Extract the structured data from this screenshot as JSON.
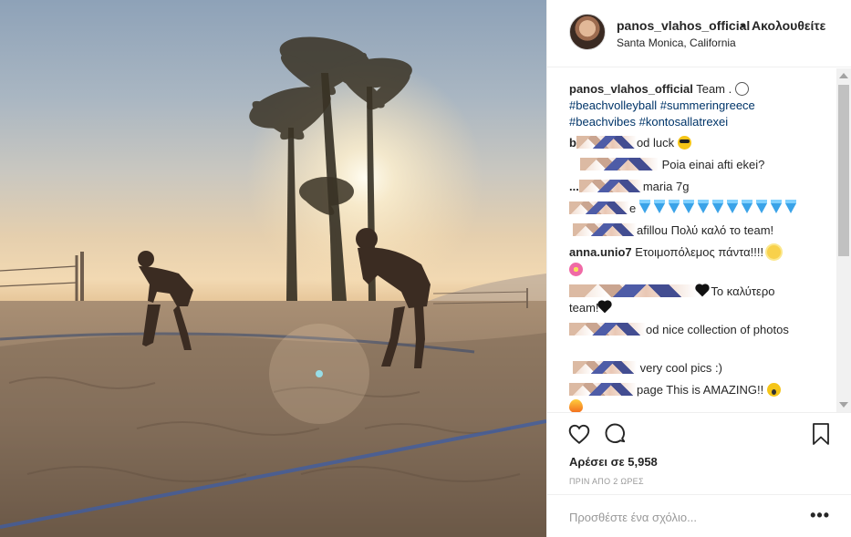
{
  "post": {
    "username": "panos_vlahos_official",
    "separator": "•",
    "follow_label": "Ακολουθείτε",
    "location": "Santa Monica, California",
    "caption_text": "Team .",
    "hashtags_line1": "#beachvolleyball #summeringreece",
    "hashtags_line2": "#beachvibes #kontosallatrexei",
    "likes": "Αρέσει σε 5,958",
    "time": "ΠΡΙΝ ΑΠΟ 2 ΩΡΕΣ",
    "comment_placeholder": "Προσθέστε ένα σχόλιο...",
    "more_label": "•••"
  },
  "comments": [
    {
      "user": "b",
      "text": "od luck"
    },
    {
      "user": "",
      "text": "Poia einai afti ekei?"
    },
    {
      "user": "...",
      "text": "maria 7g"
    },
    {
      "user": "",
      "text": "e"
    },
    {
      "user": "",
      "text": "afillou Πολύ καλό το team!"
    },
    {
      "user": "anna.unio7",
      "text": "Ετοιμοπόλεμος πάντα!!!!"
    },
    {
      "user": "",
      "text": "Το καλύτερο"
    },
    {
      "user": "",
      "text": "team!"
    },
    {
      "user": "",
      "text": "od nice collection of photos"
    },
    {
      "user": "",
      "text": "very cool pics :)"
    },
    {
      "user": "",
      "text": "page This is AMAZING!!"
    }
  ],
  "colors": {
    "hashtag": "#003569",
    "muted": "#999999",
    "text": "#262626"
  },
  "icons": [
    "heart-outline-icon",
    "comment-bubble-icon",
    "bookmark-icon",
    "more-dots-icon"
  ]
}
